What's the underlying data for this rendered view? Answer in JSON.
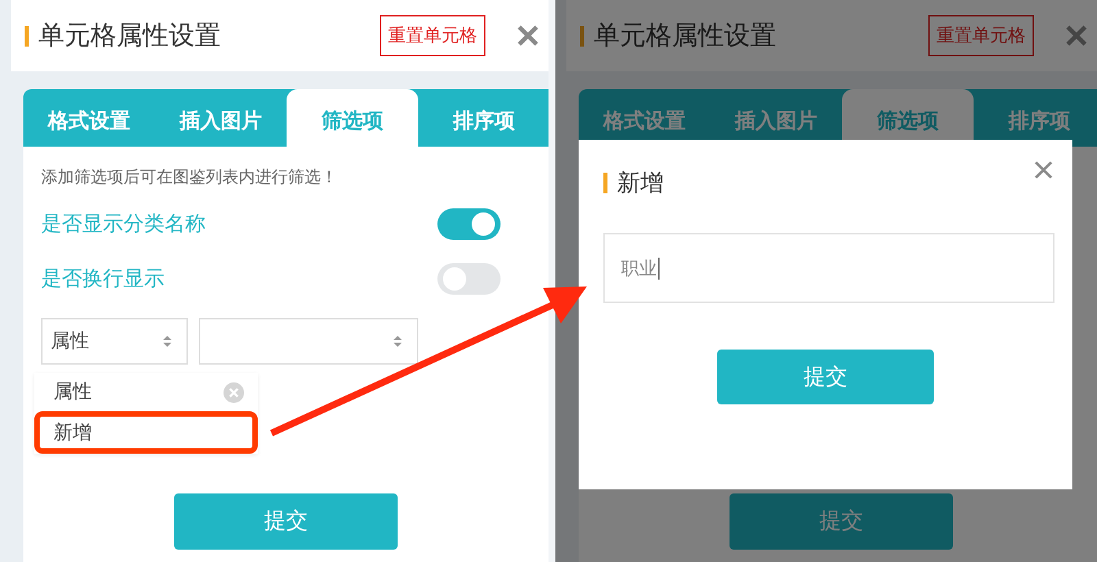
{
  "screens": [
    {
      "title": "单元格属性设置",
      "reset_button": "重置单元格",
      "dimmed": false,
      "tabs": [
        {
          "label": "格式设置",
          "selected": false
        },
        {
          "label": "插入图片",
          "selected": false
        },
        {
          "label": "筛选项",
          "selected": true
        },
        {
          "label": "排序项",
          "selected": false
        }
      ],
      "hint": "添加筛选项后可在图鉴列表内进行筛选！",
      "toggles": [
        {
          "label": "是否显示分类名称",
          "on": true
        },
        {
          "label": "是否换行显示",
          "on": false
        }
      ],
      "selects": [
        {
          "kind": "filled",
          "value": "属性"
        },
        {
          "kind": "empty"
        }
      ],
      "dropdown_options": [
        {
          "label": "属性",
          "removable": true,
          "highlighted": false
        },
        {
          "label": "新增",
          "removable": false,
          "highlighted": true
        }
      ],
      "submit_button": "提交"
    },
    {
      "title": "单元格属性设置",
      "reset_button": "重置单元格",
      "dimmed": true,
      "tabs": [
        {
          "label": "格式设置",
          "selected": false
        },
        {
          "label": "插入图片",
          "selected": false
        },
        {
          "label": "筛选项",
          "selected": true
        },
        {
          "label": "排序项",
          "selected": false
        }
      ],
      "submit_button": "提交",
      "modal": {
        "title": "新增",
        "input_value": "职业",
        "submit_button": "提交"
      }
    }
  ]
}
